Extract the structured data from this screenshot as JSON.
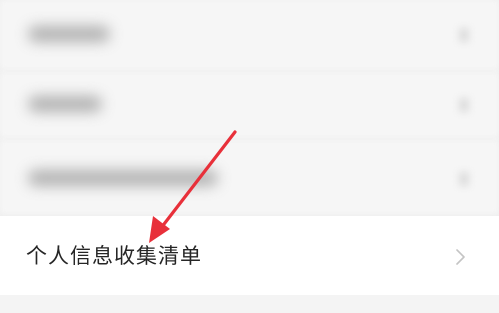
{
  "menu": {
    "items": [
      {
        "label": "个人信息收集清单"
      }
    ]
  },
  "icons": {
    "chevron": "chevron-right-icon",
    "annotation": "red-arrow-icon"
  },
  "colors": {
    "annotation_arrow": "#e8303a",
    "label_text": "#262626",
    "chevron": "#c4c4c4",
    "background": "#f4f4f4"
  }
}
